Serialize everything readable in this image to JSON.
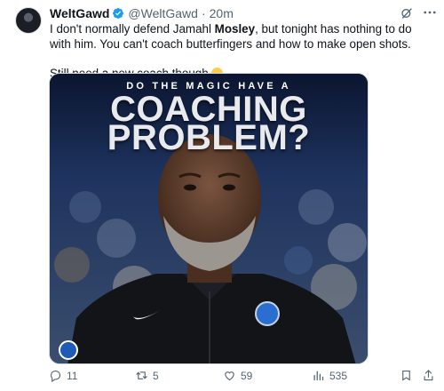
{
  "tweet": {
    "display_name": "WeltGawd",
    "handle": "@WeltGawd",
    "separator": "·",
    "time": "20m",
    "text_line1_a": "I don't normally defend Jamahl ",
    "text_line1_bold": "Mosley",
    "text_line1_b": ", but tonight has nothing to do with him. You can't coach butterfingers and how to make open shots.",
    "text_line2": "Still need a new coach though ",
    "emoji": "face-with-steam-from-nose-emoji"
  },
  "media": {
    "overline": "DO THE MAGIC HAVE A",
    "headline_line1": "COACHING",
    "headline_line2": "PROBLEM?",
    "brand_logo": "orlando-magic-logo",
    "colors": {
      "jacket": "#121418",
      "crowd_blue": "#2a4a86",
      "headline": "#e9eaee"
    }
  },
  "actions": {
    "replies": "11",
    "reposts": "5",
    "likes": "59",
    "views": "535"
  },
  "icons": [
    "verified-badge-icon",
    "grok-icon",
    "more-icon",
    "reply-icon",
    "repost-icon",
    "like-icon",
    "views-icon",
    "bookmark-icon",
    "share-icon"
  ]
}
